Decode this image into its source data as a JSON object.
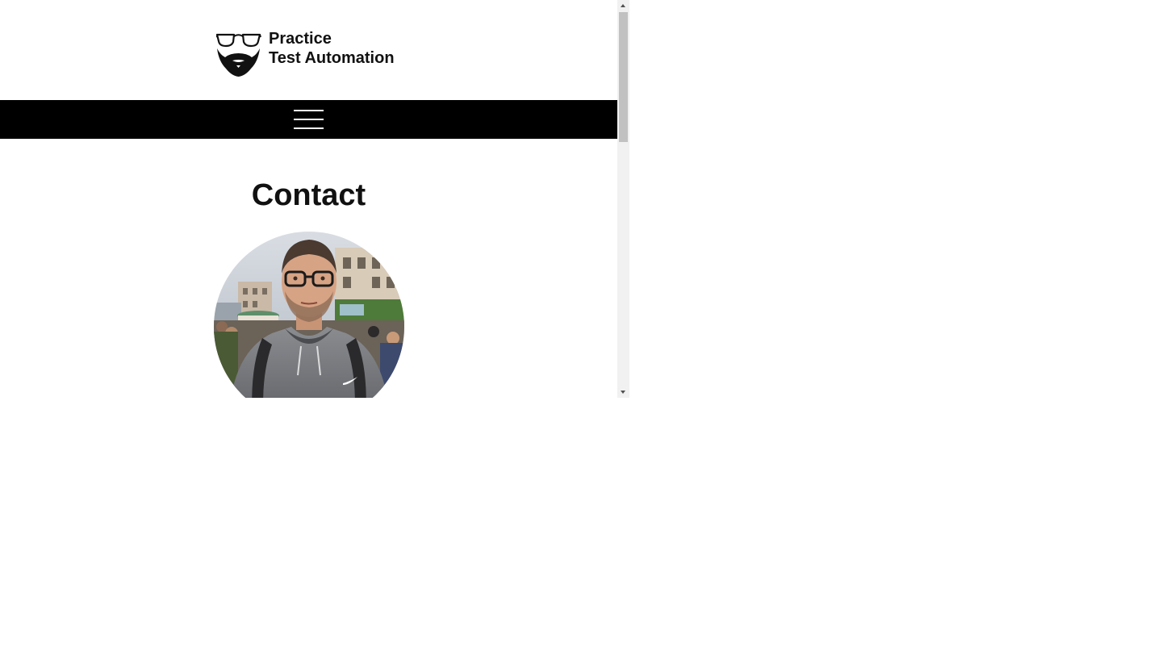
{
  "header": {
    "logo_line1": "Practice",
    "logo_line2": "Test Automation",
    "logo_icon": "glasses-beard-icon"
  },
  "nav": {
    "menu_icon": "hamburger-menu-icon",
    "background": "#000000",
    "icon_color": "#ffffff"
  },
  "main": {
    "title": "Contact",
    "portrait": "profile-photo"
  },
  "scrollbar": {
    "track_color": "#f1f1f1",
    "thumb_color": "#c1c1c1"
  }
}
